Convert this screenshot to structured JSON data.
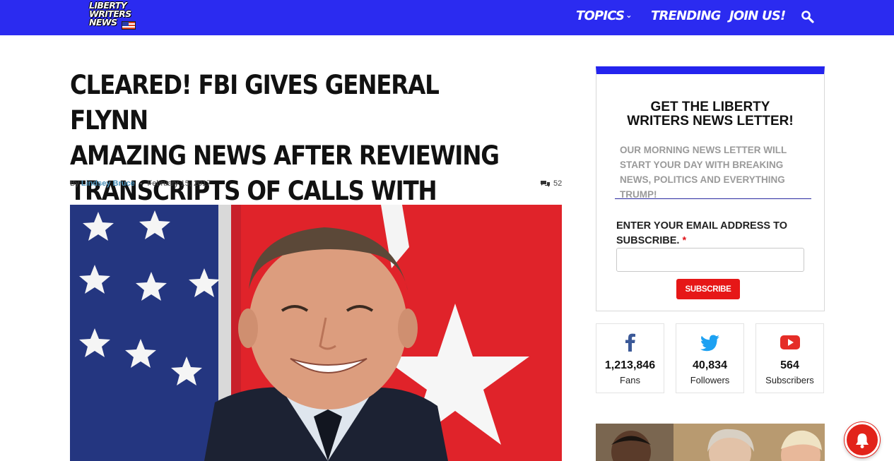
{
  "header": {
    "logo_lines": [
      "LIBERTY",
      "WRITERS",
      "NEWS"
    ],
    "nav": {
      "topics": "TOPICS",
      "trending": "TRENDING",
      "join": "JOIN US!"
    },
    "icons": {
      "search": "search-icon",
      "topics_dropdown": "chevron-down-icon"
    },
    "colors": {
      "bar": "#2b2bf0"
    }
  },
  "article": {
    "headline_lines": [
      "CLEARED! FBI GIVES GENERAL FLYNN",
      "AMAZING NEWS AFTER REVIEWING",
      "TRANSCRIPTS OF CALLS WITH RUSSIA!"
    ],
    "byline_prefix": "By",
    "author": "Lindsey Bruce",
    "separator": "-",
    "date": "February 15, 2017",
    "comment_count": "52",
    "comment_icon": "comments-icon"
  },
  "newsletter": {
    "title_lines": [
      "GET THE LIBERTY",
      "WRITERS NEWS LETTER!"
    ],
    "description": "OUR MORNING NEWS LETTER WILL START YOUR DAY WITH BREAKING NEWS, POLITICS AND EVERYTHING TRUMP!",
    "email_label": "ENTER YOUR EMAIL ADDRESS TO SUBSCRIBE.",
    "required_mark": "*",
    "email_value": "",
    "subscribe_label": "SUBSCRIBE",
    "colors": {
      "accent": "#2424ee",
      "button": "#e61717"
    }
  },
  "social": [
    {
      "network": "facebook",
      "icon": "facebook-icon",
      "count": "1,213,846",
      "label": "Fans",
      "color": "#3b5998"
    },
    {
      "network": "twitter",
      "icon": "twitter-icon",
      "count": "40,834",
      "label": "Followers",
      "color": "#1da1f2"
    },
    {
      "network": "youtube",
      "icon": "youtube-icon",
      "count": "564",
      "label": "Subscribers",
      "color": "#e52d27"
    }
  ],
  "notification": {
    "icon": "bell-icon",
    "color": "#e2231a"
  }
}
